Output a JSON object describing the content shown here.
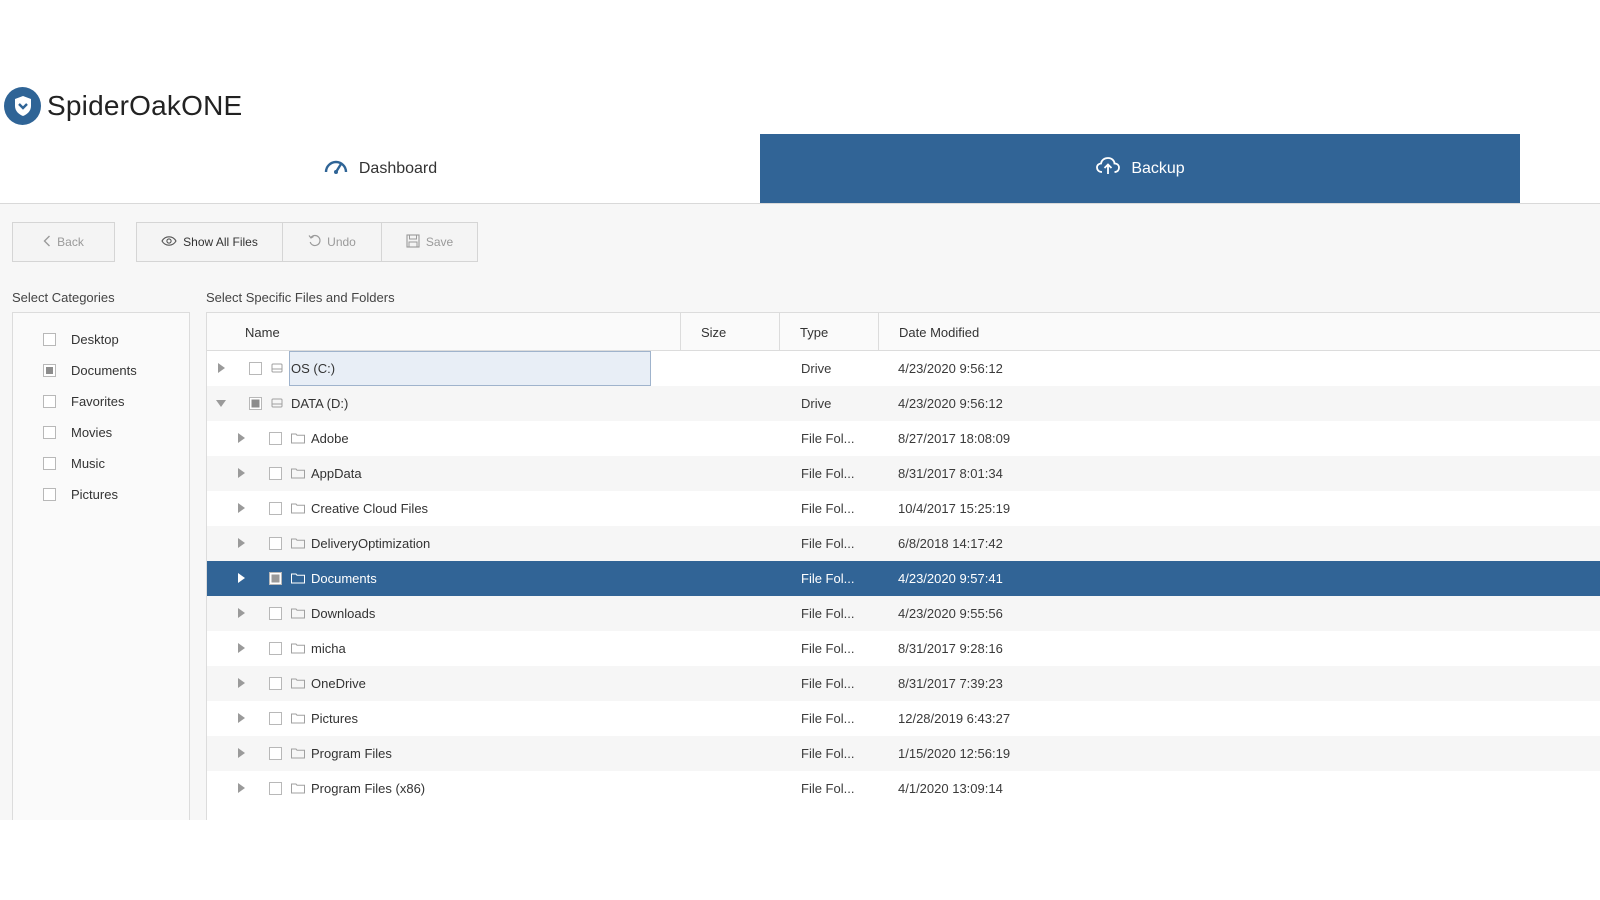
{
  "app": {
    "name": "SpiderOakONE"
  },
  "tabs": [
    {
      "label": "Dashboard",
      "active": false
    },
    {
      "label": "Backup",
      "active": true
    }
  ],
  "toolbar": {
    "back": "Back",
    "show_all": "Show All Files",
    "undo": "Undo",
    "save": "Save"
  },
  "labels": {
    "categories": "Select Categories",
    "files": "Select Specific Files and Folders"
  },
  "categories": [
    {
      "label": "Desktop",
      "state": "unchecked"
    },
    {
      "label": "Documents",
      "state": "partial"
    },
    {
      "label": "Favorites",
      "state": "unchecked"
    },
    {
      "label": "Movies",
      "state": "unchecked"
    },
    {
      "label": "Music",
      "state": "unchecked"
    },
    {
      "label": "Pictures",
      "state": "unchecked"
    }
  ],
  "table": {
    "columns": [
      "Name",
      "Size",
      "Type",
      "Date Modified"
    ],
    "rows": [
      {
        "name": "OS (C:)",
        "type": "Drive",
        "date": "4/23/2020 9:56:12",
        "level": 0,
        "expanded": false,
        "icon": "drive-icon",
        "check": "unchecked",
        "editing": true
      },
      {
        "name": "DATA (D:)",
        "type": "Drive",
        "date": "4/23/2020 9:56:12",
        "level": 0,
        "expanded": true,
        "icon": "drive-icon",
        "check": "partial"
      },
      {
        "name": "Adobe",
        "type": "File Fol...",
        "date": "8/27/2017 18:08:09",
        "level": 1,
        "expanded": false,
        "icon": "folder-icon",
        "check": "unchecked"
      },
      {
        "name": "AppData",
        "type": "File Fol...",
        "date": "8/31/2017 8:01:34",
        "level": 1,
        "expanded": false,
        "icon": "folder-icon",
        "check": "unchecked"
      },
      {
        "name": "Creative Cloud Files",
        "type": "File Fol...",
        "date": "10/4/2017 15:25:19",
        "level": 1,
        "expanded": false,
        "icon": "folder-icon",
        "check": "unchecked"
      },
      {
        "name": "DeliveryOptimization",
        "type": "File Fol...",
        "date": "6/8/2018 14:17:42",
        "level": 1,
        "expanded": false,
        "icon": "folder-icon",
        "check": "unchecked"
      },
      {
        "name": "Documents",
        "type": "File Fol...",
        "date": "4/23/2020 9:57:41",
        "level": 1,
        "expanded": false,
        "icon": "folder-icon",
        "check": "partial",
        "selected": true
      },
      {
        "name": "Downloads",
        "type": "File Fol...",
        "date": "4/23/2020 9:55:56",
        "level": 1,
        "expanded": false,
        "icon": "folder-icon",
        "check": "unchecked"
      },
      {
        "name": "micha",
        "type": "File Fol...",
        "date": "8/31/2017 9:28:16",
        "level": 1,
        "expanded": false,
        "icon": "folder-icon",
        "check": "unchecked"
      },
      {
        "name": "OneDrive",
        "type": "File Fol...",
        "date": "8/31/2017 7:39:23",
        "level": 1,
        "expanded": false,
        "icon": "folder-icon",
        "check": "unchecked"
      },
      {
        "name": "Pictures",
        "type": "File Fol...",
        "date": "12/28/2019 6:43:27",
        "level": 1,
        "expanded": false,
        "icon": "folder-icon",
        "check": "unchecked"
      },
      {
        "name": "Program Files",
        "type": "File Fol...",
        "date": "1/15/2020 12:56:19",
        "level": 1,
        "expanded": false,
        "icon": "folder-icon",
        "check": "unchecked"
      },
      {
        "name": "Program Files (x86)",
        "type": "File Fol...",
        "date": "4/1/2020 13:09:14",
        "level": 1,
        "expanded": false,
        "icon": "folder-icon",
        "check": "unchecked"
      }
    ]
  },
  "colors": {
    "accent": "#316496",
    "content_bg": "#f7f7f7"
  }
}
